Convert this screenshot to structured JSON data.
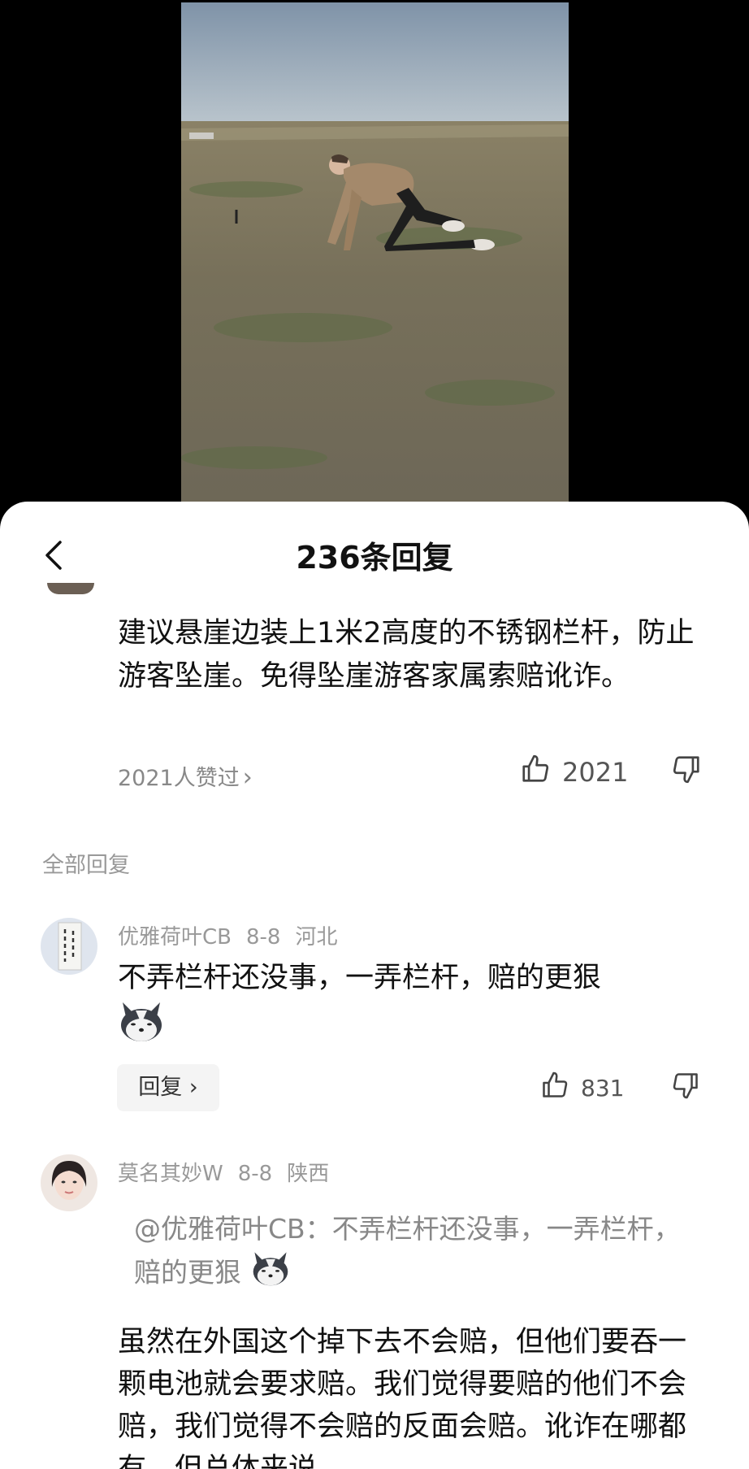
{
  "header": {
    "title": "236条回复"
  },
  "main_comment": {
    "text": "建议悬崖边装上1米2高度的不锈钢栏杆，防止游客坠崖。免得坠崖游客家属索赔讹诈。",
    "liked_by": "2021人赞过",
    "likes": "2021"
  },
  "section_label": "全部回复",
  "replies": [
    {
      "user": "优雅荷叶CB",
      "date": "8-8",
      "location": "河北",
      "text": "不弄栏杆还没事，一弄栏杆，赔的更狠",
      "emoji": "husky-dog-emoji",
      "reply_label": "回复",
      "likes": "831"
    },
    {
      "user": "莫名其妙W",
      "date": "8-8",
      "location": "陕西",
      "quote": "@优雅荷叶CB：不弄栏杆还没事，一弄栏杆，赔的更狠",
      "text": "虽然在外国这个掉下去不会赔，但他们要吞一颗电池就会要求赔。我们觉得要赔的他们不会赔，我们觉得不会赔的反面会赔。讹诈在哪都有，但总体来说"
    }
  ],
  "icons": {
    "back": "chevron-left-icon",
    "like": "thumbs-up-icon",
    "dislike": "thumbs-down-icon",
    "chevron": "chevron-right-icon"
  },
  "colors": {
    "sheet_bg": "#ffffff",
    "muted_text": "#999999",
    "sky": "#8ea0b3",
    "field": "#7a7257"
  }
}
